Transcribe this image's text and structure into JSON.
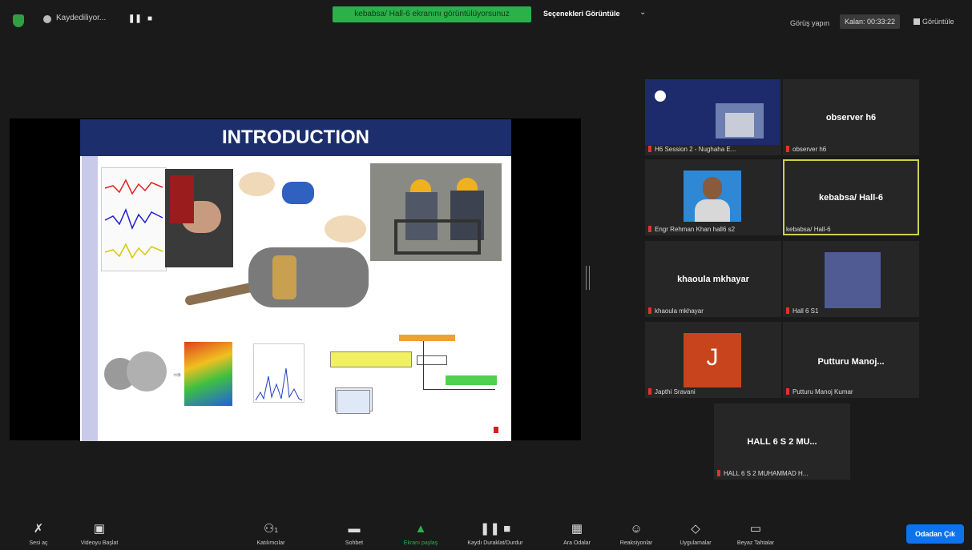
{
  "top": {
    "recording": "Kaydediliyor...",
    "pause": "❚❚",
    "stop": "■",
    "viewing_banner": "kebabsa/ Hall-6 ekranını görüntülüyorsunuz",
    "view_options": "Seçenekleri Görüntüle",
    "view_chevron": "⌄",
    "exit_fullscreen": "Görüş yapın",
    "timer": "Kalan: 00:33:22",
    "view_label": "Görüntüle"
  },
  "slide": {
    "title": "INTRODUCTION"
  },
  "participants": [
    {
      "display": "",
      "label": "H6 Session 2 - Nughaha E..."
    },
    {
      "display": "observer h6",
      "label": "observer h6"
    },
    {
      "display": "",
      "label": "Engr Rehman Khan hall6 s2"
    },
    {
      "display": "kebabsa/ Hall-6",
      "label": "kebabsa/ Hall-6"
    },
    {
      "display": "khaoula mkhayar",
      "label": "khaoula mkhayar"
    },
    {
      "display": "",
      "label": "Hall 6 S1"
    },
    {
      "display": "J",
      "label": "Japthi Sravani"
    },
    {
      "display": "Putturu  Manoj...",
      "label": "Putturu Manoj Kumar"
    },
    {
      "display": "HALL 6 S 2 MU...",
      "label": "HALL 6 S 2 MUHAMMAD H..."
    }
  ],
  "toolbar": {
    "unmute": "Sesi aç",
    "start_video": "Videoyu Başlat",
    "participants": "Katılımcılar",
    "participants_count": "1",
    "chat": "Sohbet",
    "share": "Ekranı paylaş",
    "pause_share": "Kaydı Duraklat/Durdur",
    "breakout": "Ara Odalar",
    "reactions": "Reaksiyonlar",
    "apps": "Uygulamalar",
    "whiteboard": "Beyaz Tahtalar",
    "leave": "Odadan Çık"
  },
  "colors": {
    "banner": "#2bb04a",
    "active_border": "#cfd04a",
    "leave": "#0d72ed",
    "avatar_j": "#c8441c"
  }
}
